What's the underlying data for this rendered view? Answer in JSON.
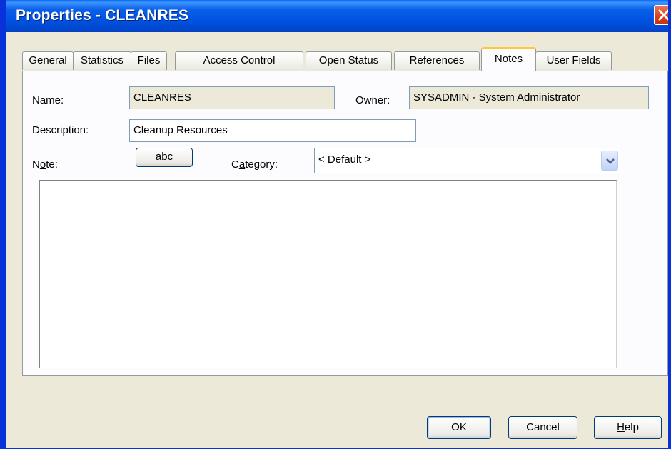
{
  "window": {
    "title": "Properties - CLEANRES"
  },
  "tabs": [
    {
      "label": "General"
    },
    {
      "label": "Statistics"
    },
    {
      "label": "Files"
    },
    {
      "label": "Access Control"
    },
    {
      "label": "Open Status"
    },
    {
      "label": "References"
    },
    {
      "label": "Notes"
    },
    {
      "label": "User Fields"
    }
  ],
  "active_tab": "Notes",
  "form": {
    "name_label": "Name:",
    "name_value": "CLEANRES",
    "owner_label": "Owner:",
    "owner_value": "SYSADMIN - System Administrator",
    "description_label": "Description:",
    "description_value": "Cleanup Resources",
    "note_label_pre": "N",
    "note_label_ul": "o",
    "note_label_post": "te:",
    "spell_button": "abc",
    "category_label_pre": "C",
    "category_label_ul": "a",
    "category_label_post": "tegory:",
    "category_value": "< Default >",
    "note_text": ""
  },
  "buttons": {
    "ok": "OK",
    "cancel": "Cancel",
    "help_ul": "H",
    "help_rest": "elp"
  },
  "icons": {
    "close": "close-icon",
    "dropdown": "chevron-down-icon"
  },
  "colors": {
    "title_bar": "#0054e3",
    "dialog_bg": "#ece9d8",
    "active_tab_accent": "#ffc83c",
    "close_button": "#d8401d"
  }
}
